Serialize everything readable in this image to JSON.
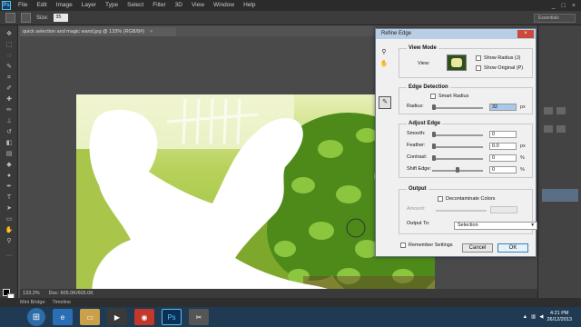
{
  "menubar": {
    "logo": "Ps",
    "items": [
      "File",
      "Edit",
      "Image",
      "Layer",
      "Type",
      "Select",
      "Filter",
      "3D",
      "View",
      "Window",
      "Help"
    ],
    "window_controls": [
      "_",
      "□",
      "×"
    ]
  },
  "options_bar": {
    "size_label": "Size:",
    "size_value": "35",
    "workspace": "Essentials"
  },
  "document": {
    "tab_title": "quick selection and magic wand.jpg @ 133% (RGB/8#)",
    "zoom": "133.2%",
    "doc_size": "Doc: 605.0K/605.0K"
  },
  "bottom_tabs": [
    "Mini Bridge",
    "Timeline"
  ],
  "dialog": {
    "title": "Refine Edge",
    "close": "×",
    "view_mode": {
      "title": "View Mode",
      "view_label": "View:",
      "show_radius": "Show Radius (J)",
      "show_original": "Show Original (P)"
    },
    "edge_detection": {
      "title": "Edge Detection",
      "smart_radius": "Smart Radius",
      "radius_label": "Radius:",
      "radius_value": "32",
      "radius_unit": "px"
    },
    "adjust_edge": {
      "title": "Adjust Edge",
      "rows": [
        {
          "label": "Smooth:",
          "value": "0",
          "unit": "",
          "knob": 0.0
        },
        {
          "label": "Feather:",
          "value": "0.0",
          "unit": "px",
          "knob": 0.0
        },
        {
          "label": "Contrast:",
          "value": "0",
          "unit": "%",
          "knob": 0.0
        },
        {
          "label": "Shift Edge:",
          "value": "0",
          "unit": "%",
          "knob": 0.5
        }
      ]
    },
    "output": {
      "title": "Output",
      "decontaminate": "Decontaminate Colors",
      "amount_label": "Amount:",
      "output_to_label": "Output To:",
      "output_to_value": "Selection"
    },
    "remember": "Remember Settings",
    "cancel": "Cancel",
    "ok": "OK"
  },
  "taskbar": {
    "time": "4:21 PM",
    "date": "26/12/2013"
  }
}
